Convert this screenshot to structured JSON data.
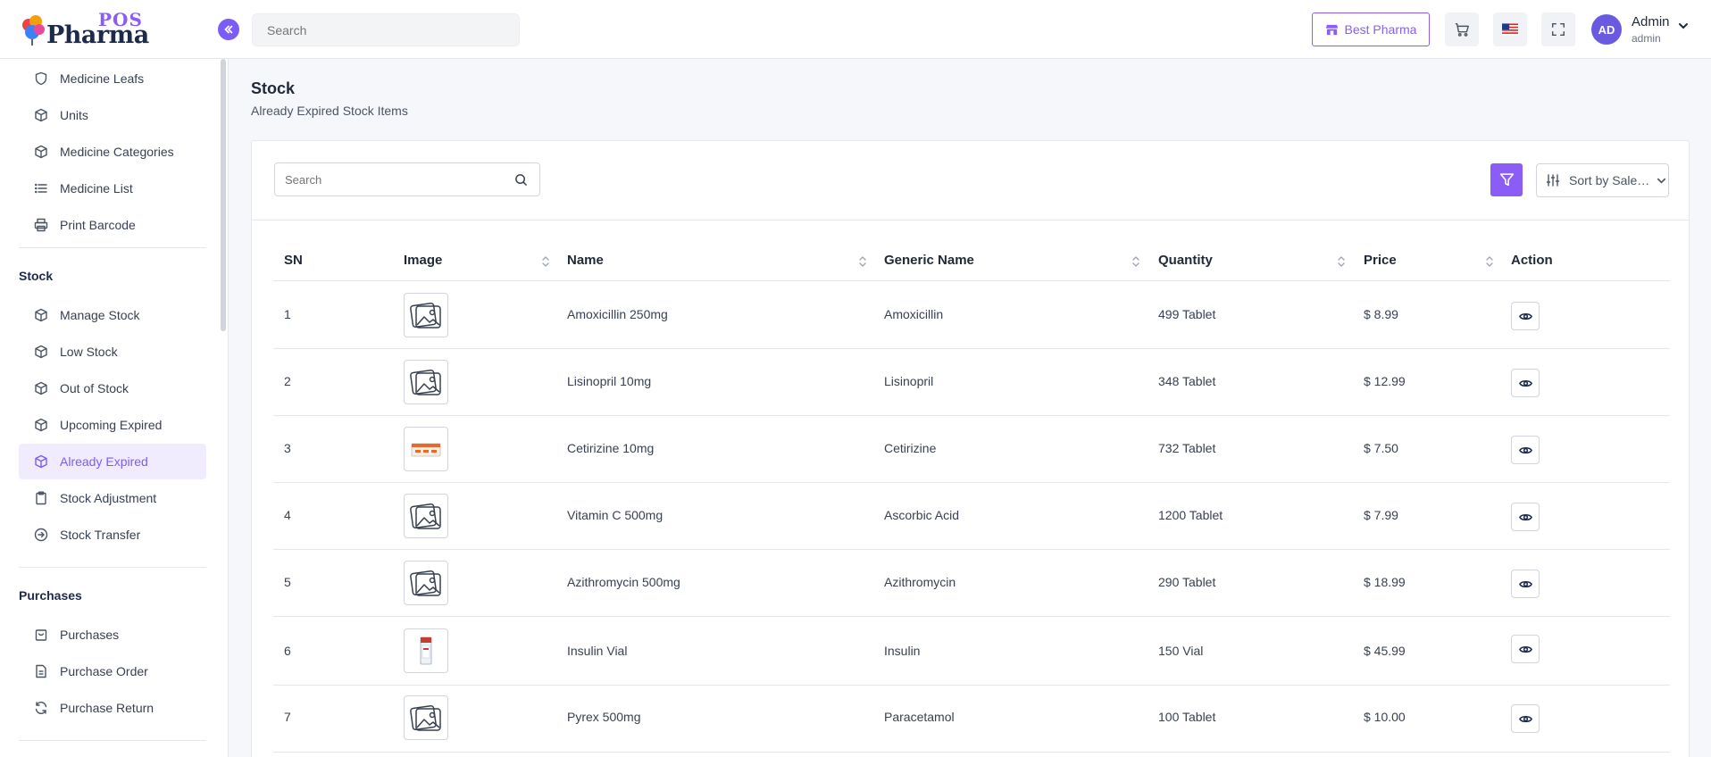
{
  "header": {
    "brand_pos": "POS",
    "brand_name": "Pharma",
    "search_placeholder": "Search",
    "store_label": "Best Pharma",
    "user_initials": "AD",
    "user_name": "Admin",
    "user_role": "admin"
  },
  "sidebar": {
    "items_top": [
      {
        "label": "Medicine Leafs",
        "icon": "shield-icon"
      },
      {
        "label": "Units",
        "icon": "cube-icon"
      },
      {
        "label": "Medicine Categories",
        "icon": "cube-icon"
      },
      {
        "label": "Medicine List",
        "icon": "list-icon"
      },
      {
        "label": "Print Barcode",
        "icon": "printer-icon"
      }
    ],
    "stock_section": "Stock",
    "stock_items": [
      {
        "label": "Manage Stock",
        "icon": "cube-icon"
      },
      {
        "label": "Low Stock",
        "icon": "cube-icon"
      },
      {
        "label": "Out of Stock",
        "icon": "cube-icon"
      },
      {
        "label": "Upcoming Expired",
        "icon": "cube-icon"
      },
      {
        "label": "Already Expired",
        "icon": "cube-icon",
        "active": true
      },
      {
        "label": "Stock Adjustment",
        "icon": "clipboard-icon"
      },
      {
        "label": "Stock Transfer",
        "icon": "arrow-circle-icon"
      }
    ],
    "purchases_section": "Purchases",
    "purchases_items": [
      {
        "label": "Purchases",
        "icon": "bag-icon"
      },
      {
        "label": "Purchase Order",
        "icon": "file-icon"
      },
      {
        "label": "Purchase Return",
        "icon": "refresh-icon"
      }
    ]
  },
  "page": {
    "title": "Stock",
    "subtitle": "Already Expired Stock Items"
  },
  "toolbar": {
    "search_placeholder": "Search",
    "sort_label": "Sort by Sale Price"
  },
  "table": {
    "columns": [
      "SN",
      "Image",
      "Name",
      "Generic Name",
      "Quantity",
      "Price",
      "Action"
    ],
    "rows": [
      {
        "sn": "1",
        "image": "placeholder",
        "name": "Amoxicillin 250mg",
        "generic": "Amoxicillin",
        "qty": "499 Tablet",
        "price": "$ 8.99"
      },
      {
        "sn": "2",
        "image": "placeholder",
        "name": "Lisinopril 10mg",
        "generic": "Lisinopril",
        "qty": "348 Tablet",
        "price": "$ 12.99"
      },
      {
        "sn": "3",
        "image": "product-box",
        "name": "Cetirizine 10mg",
        "generic": "Cetirizine",
        "qty": "732 Tablet",
        "price": "$ 7.50"
      },
      {
        "sn": "4",
        "image": "placeholder",
        "name": "Vitamin C 500mg",
        "generic": "Ascorbic Acid",
        "qty": "1200 Tablet",
        "price": "$ 7.99"
      },
      {
        "sn": "5",
        "image": "placeholder",
        "name": "Azithromycin 500mg",
        "generic": "Azithromycin",
        "qty": "290 Tablet",
        "price": "$ 18.99"
      },
      {
        "sn": "6",
        "image": "vial",
        "name": "Insulin Vial",
        "generic": "Insulin",
        "qty": "150 Vial",
        "price": "$ 45.99"
      },
      {
        "sn": "7",
        "image": "placeholder",
        "name": "Pyrex 500mg",
        "generic": "Paracetamol",
        "qty": "100 Tablet",
        "price": "$ 10.00"
      }
    ]
  },
  "colors": {
    "accent": "#8b5cf6",
    "active_bg": "#f0ecfd",
    "brand_dark": "#1e2a4a"
  }
}
